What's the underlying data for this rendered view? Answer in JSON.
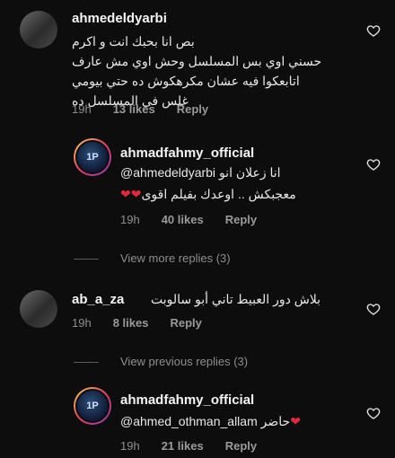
{
  "comments": [
    {
      "username": "ahmedeldyarbi",
      "lines": [
        "بص انا بحبك انت و اكرم",
        "حسني اوي بس المسلسل وحش اوي مش عارف",
        "اتابعكوا فيه عشان مكرهكوش ده حتي بيومي",
        "غلس في المسلسل ده"
      ],
      "time": "19h",
      "likes": "13 likes",
      "reply": "Reply"
    },
    {
      "username": "ahmadfahmy_official",
      "line1_mention": "@ahmedeldyarbi",
      "line1_text": "انا زعلان انو",
      "line2_text": "معجبكش .. اوعدك بفيلم اقوى",
      "line2_hearts": "❤❤",
      "time": "19h",
      "likes": "40 likes",
      "reply": "Reply"
    },
    {
      "username": "ab_a_za",
      "text": "بلاش دور العبيط تاني أبو سالوبت",
      "time": "19h",
      "likes": "8 likes",
      "reply": "Reply"
    },
    {
      "username": "ahmadfahmy_official",
      "mention": "@ahmed_othman_allam",
      "text": "حاضر",
      "heart": "❤",
      "time": "19h",
      "likes": "21 likes",
      "reply": "Reply"
    }
  ],
  "view_more_replies": "View more replies (3)",
  "view_previous_replies": "View previous replies (3)",
  "avatar_badge": "1P",
  "icons": {
    "like": "heart-outline-icon"
  },
  "colors": {
    "background": "#0d0d0d",
    "meta": "#8e8e8e",
    "heart_red": "#e02a3c"
  }
}
